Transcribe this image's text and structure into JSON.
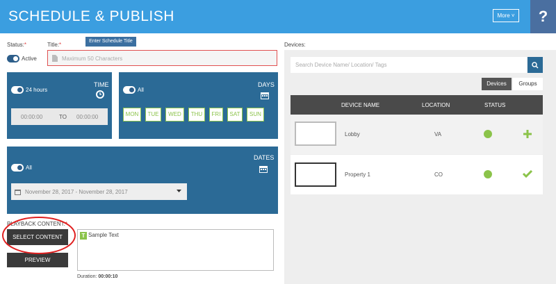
{
  "header": {
    "title": "SCHEDULE & PUBLISH",
    "more_label": "More ˅",
    "help_label": "?"
  },
  "form": {
    "status_label": "Status:",
    "title_label": "Title:",
    "required_mark": "*",
    "status_value": "Active",
    "title_tooltip": "Enter Schedule Title",
    "title_placeholder": "Maximum 50 Characters"
  },
  "time_panel": {
    "toggle_label": "24 hours",
    "heading": "TIME",
    "start_time": "00:00:00",
    "to_label": "TO",
    "end_time": "00:00:00"
  },
  "days_panel": {
    "toggle_label": "All",
    "heading": "DAYS",
    "days": [
      "MON",
      "TUE",
      "WED",
      "THU",
      "FRI",
      "SAT",
      "SUN"
    ]
  },
  "dates_panel": {
    "toggle_label": "All",
    "heading": "DATES",
    "date_range": "November 28, 2017 - November 28, 2017"
  },
  "playback": {
    "label": "PLAYBACK CONTENT:",
    "select_button": "SELECT CONTENT",
    "preview_button": "PREVIEW",
    "content_badge": "T",
    "content_text": "Sample Text",
    "duration_label": "Duration:",
    "duration_value": "00:00:10"
  },
  "devices": {
    "section_label": "Devices:",
    "search_placeholder": "Search Device Name/ Location/ Tags",
    "tabs": [
      "Devices",
      "Groups"
    ],
    "columns": [
      "DEVICE NAME",
      "LOCATION",
      "STATUS"
    ],
    "rows": [
      {
        "name": "Lobby",
        "location": "VA",
        "status_color": "#8bc34a",
        "action": "add"
      },
      {
        "name": "Property 1",
        "location": "CO",
        "status_color": "#8bc34a",
        "action": "selected"
      }
    ]
  },
  "colors": {
    "header": "#3b9ee0",
    "panel": "#2b6a96",
    "accent_green": "#8bc34a",
    "annotation_red": "#e02020"
  }
}
